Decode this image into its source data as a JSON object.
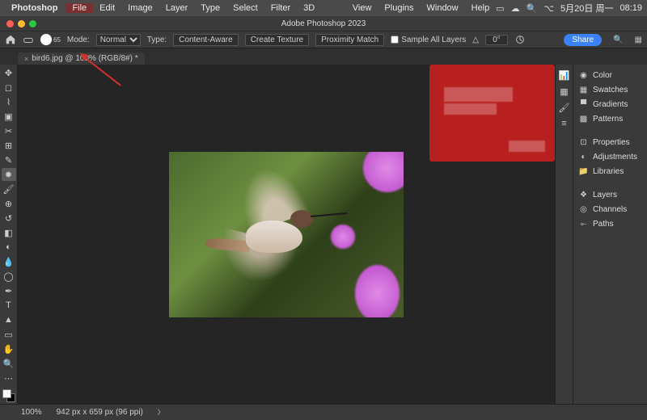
{
  "menubar": {
    "app": "Photoshop",
    "items": [
      "File",
      "Edit",
      "Image",
      "Layer",
      "Type",
      "Select",
      "Filter",
      "3D"
    ],
    "right_items": [
      "View",
      "Plugins",
      "Window",
      "Help"
    ],
    "date": "5月20日 周一",
    "time": "08:19"
  },
  "window": {
    "title": "Adobe Photoshop 2023"
  },
  "options": {
    "brush_size": "65",
    "mode_label": "Mode:",
    "mode_value": "Normal",
    "type_label": "Type:",
    "type_value": "Content-Aware",
    "btn_texture": "Create Texture",
    "btn_proximity": "Proximity Match",
    "sample_all": "Sample All Layers",
    "angle_icon": "△",
    "angle_value": "0°",
    "share": "Share"
  },
  "tab": {
    "label": "bird6.jpg @ 100% (RGB/8#) *"
  },
  "panels": {
    "color": "Color",
    "swatches": "Swatches",
    "gradients": "Gradients",
    "patterns": "Patterns",
    "properties": "Properties",
    "adjustments": "Adjustments",
    "libraries": "Libraries",
    "layers": "Layers",
    "channels": "Channels",
    "paths": "Paths"
  },
  "status": {
    "zoom": "100%",
    "dims": "942 px x 659 px (96 ppi)"
  },
  "highlight_menu_index": 0
}
